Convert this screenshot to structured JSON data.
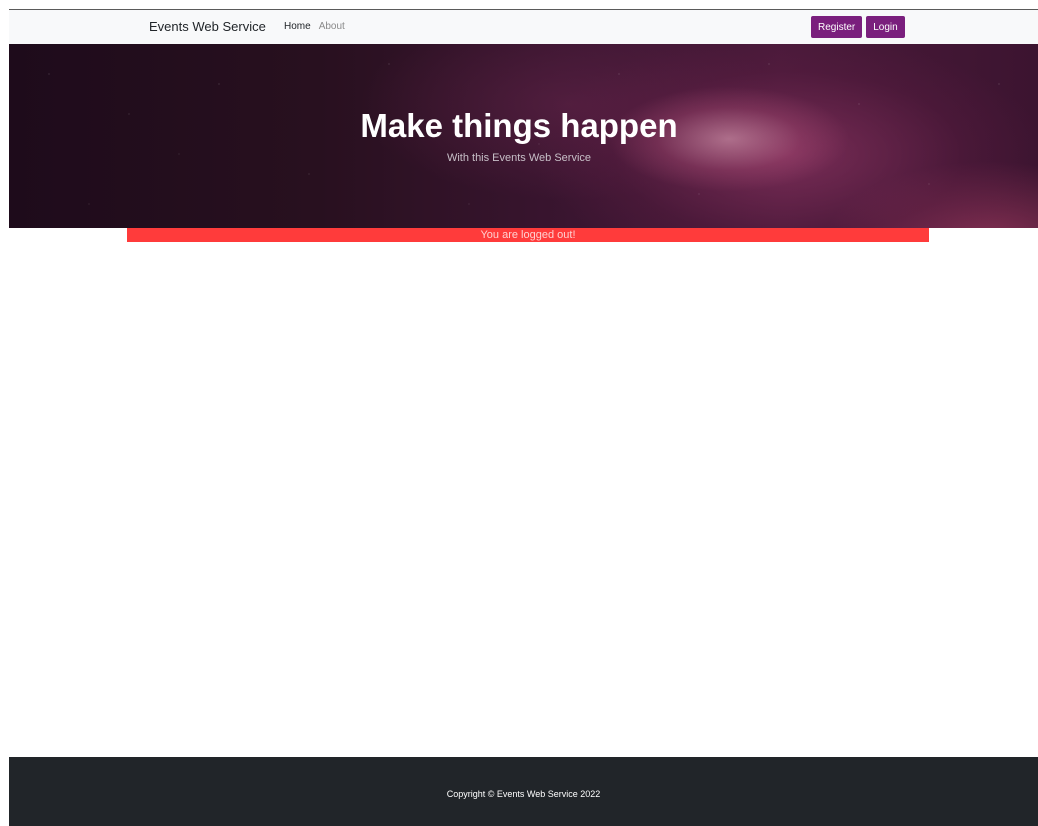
{
  "navbar": {
    "brand": "Events Web Service",
    "links": [
      {
        "label": "Home"
      },
      {
        "label": "About"
      }
    ],
    "register_label": "Register",
    "login_label": "Login",
    "button_color": "#7a1f7d"
  },
  "hero": {
    "title": "Make things happen",
    "subtitle": "With this Events Web Service"
  },
  "alert": {
    "message": "You are logged out!",
    "color": "#ff3b3b"
  },
  "footer": {
    "copyright": "Copyright © Events Web Service 2022"
  }
}
